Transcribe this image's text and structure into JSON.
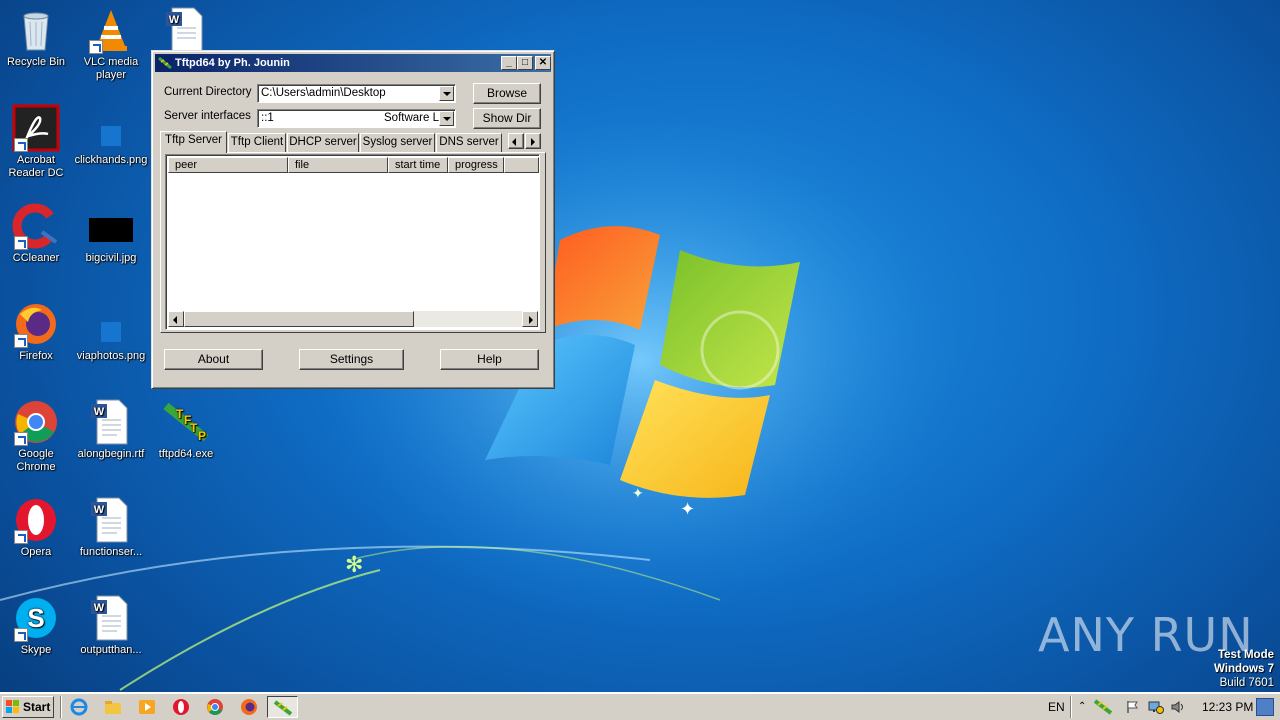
{
  "desktop": {
    "icons": [
      {
        "label": "Recycle Bin",
        "icon": "recycle-bin-icon"
      },
      {
        "label": "VLC media player",
        "icon": "vlc-icon"
      },
      {
        "label": "",
        "icon": "word-document-icon"
      },
      {
        "label": "Acrobat Reader DC",
        "icon": "acrobat-icon"
      },
      {
        "label": "clickhands.png",
        "icon": "image-file-icon"
      },
      {
        "label": "CCleaner",
        "icon": "ccleaner-icon"
      },
      {
        "label": "bigcivil.jpg",
        "icon": "image-file-icon"
      },
      {
        "label": "Firefox",
        "icon": "firefox-icon"
      },
      {
        "label": "viaphotos.png",
        "icon": "image-file-icon"
      },
      {
        "label": "Google Chrome",
        "icon": "chrome-icon"
      },
      {
        "label": "alongbegin.rtf",
        "icon": "word-document-icon"
      },
      {
        "label": "tftpd64.exe",
        "icon": "tftpd-icon"
      },
      {
        "label": "Opera",
        "icon": "opera-icon"
      },
      {
        "label": "functionser...",
        "icon": "word-document-icon"
      },
      {
        "label": "Skype",
        "icon": "skype-icon"
      },
      {
        "label": "outputthan...",
        "icon": "word-document-icon"
      }
    ]
  },
  "window": {
    "title": "Tftpd64 by Ph. Jounin",
    "minimize_label": "_",
    "maximize_label": "□",
    "close_label": "✕",
    "current_directory_label": "Current Directory",
    "current_directory_value": "C:\\Users\\admin\\Desktop",
    "server_interfaces_label": "Server interfaces",
    "server_interface_value": "::1",
    "server_interface_desc": "Software Lo",
    "browse_label": "Browse",
    "show_dir_label": "Show Dir",
    "tabs": [
      "Tftp Server",
      "Tftp Client",
      "DHCP server",
      "Syslog server",
      "DNS server"
    ],
    "columns": [
      "peer",
      "file",
      "start time",
      "progress"
    ],
    "about_label": "About",
    "settings_label": "Settings",
    "help_label": "Help"
  },
  "taskbar": {
    "start_label": "Start",
    "language": "EN",
    "clock": "12:23 PM"
  },
  "watermark": {
    "brand": "ANY RUN",
    "test_mode": "Test Mode",
    "os": "Windows 7",
    "build": "Build 7601"
  }
}
